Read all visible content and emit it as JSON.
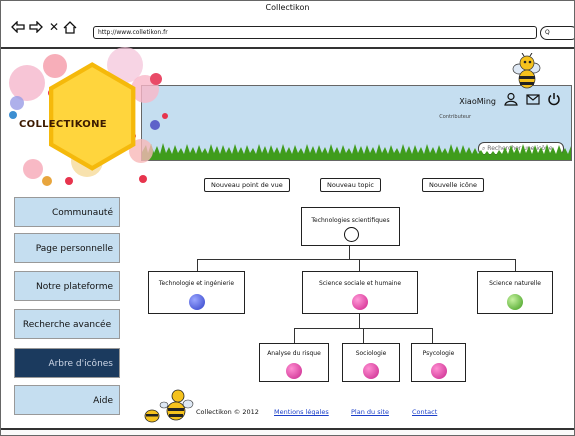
{
  "window": {
    "title": "Collectikon"
  },
  "address_bar": {
    "url": "http://www.colletikon.fr"
  },
  "search_pill": {
    "label": "Q"
  },
  "logo": {
    "text": "COLLECTIKONE"
  },
  "user": {
    "name": "XiaoMing",
    "role": "Contributeur"
  },
  "icon_search": {
    "placeholder": "Rechercher une icône"
  },
  "actions": [
    {
      "label": "Nouveau point de vue"
    },
    {
      "label": "Nouveau topic"
    },
    {
      "label": "Nouvelle icône"
    }
  ],
  "sidebar": {
    "items": [
      {
        "label": "Communauté"
      },
      {
        "label": "Page personnelle"
      },
      {
        "label": "Notre plateforme"
      },
      {
        "label": "Recherche avancée"
      },
      {
        "label": "Arbre d'icônes"
      },
      {
        "label": "Aide"
      }
    ]
  },
  "tree": {
    "root": {
      "label": "Technologies scientifiques"
    },
    "level1": [
      {
        "label": "Technologie et ingénierie",
        "color": "#4a5bd8"
      },
      {
        "label": "Science sociale et humaine",
        "color": "#e0359a"
      },
      {
        "label": "Science naturelle",
        "color": "#62c43c"
      }
    ],
    "level2": [
      {
        "label": "Analyse du risque",
        "color": "#d0309a"
      },
      {
        "label": "Sociologie",
        "color": "#d0309a"
      },
      {
        "label": "Psycologie",
        "color": "#d0309a"
      }
    ]
  },
  "footer": {
    "copyright": "Collectikon © 2012",
    "links": [
      {
        "label": "Mentions légales"
      },
      {
        "label": "Plan du site"
      },
      {
        "label": "Contact"
      }
    ]
  }
}
